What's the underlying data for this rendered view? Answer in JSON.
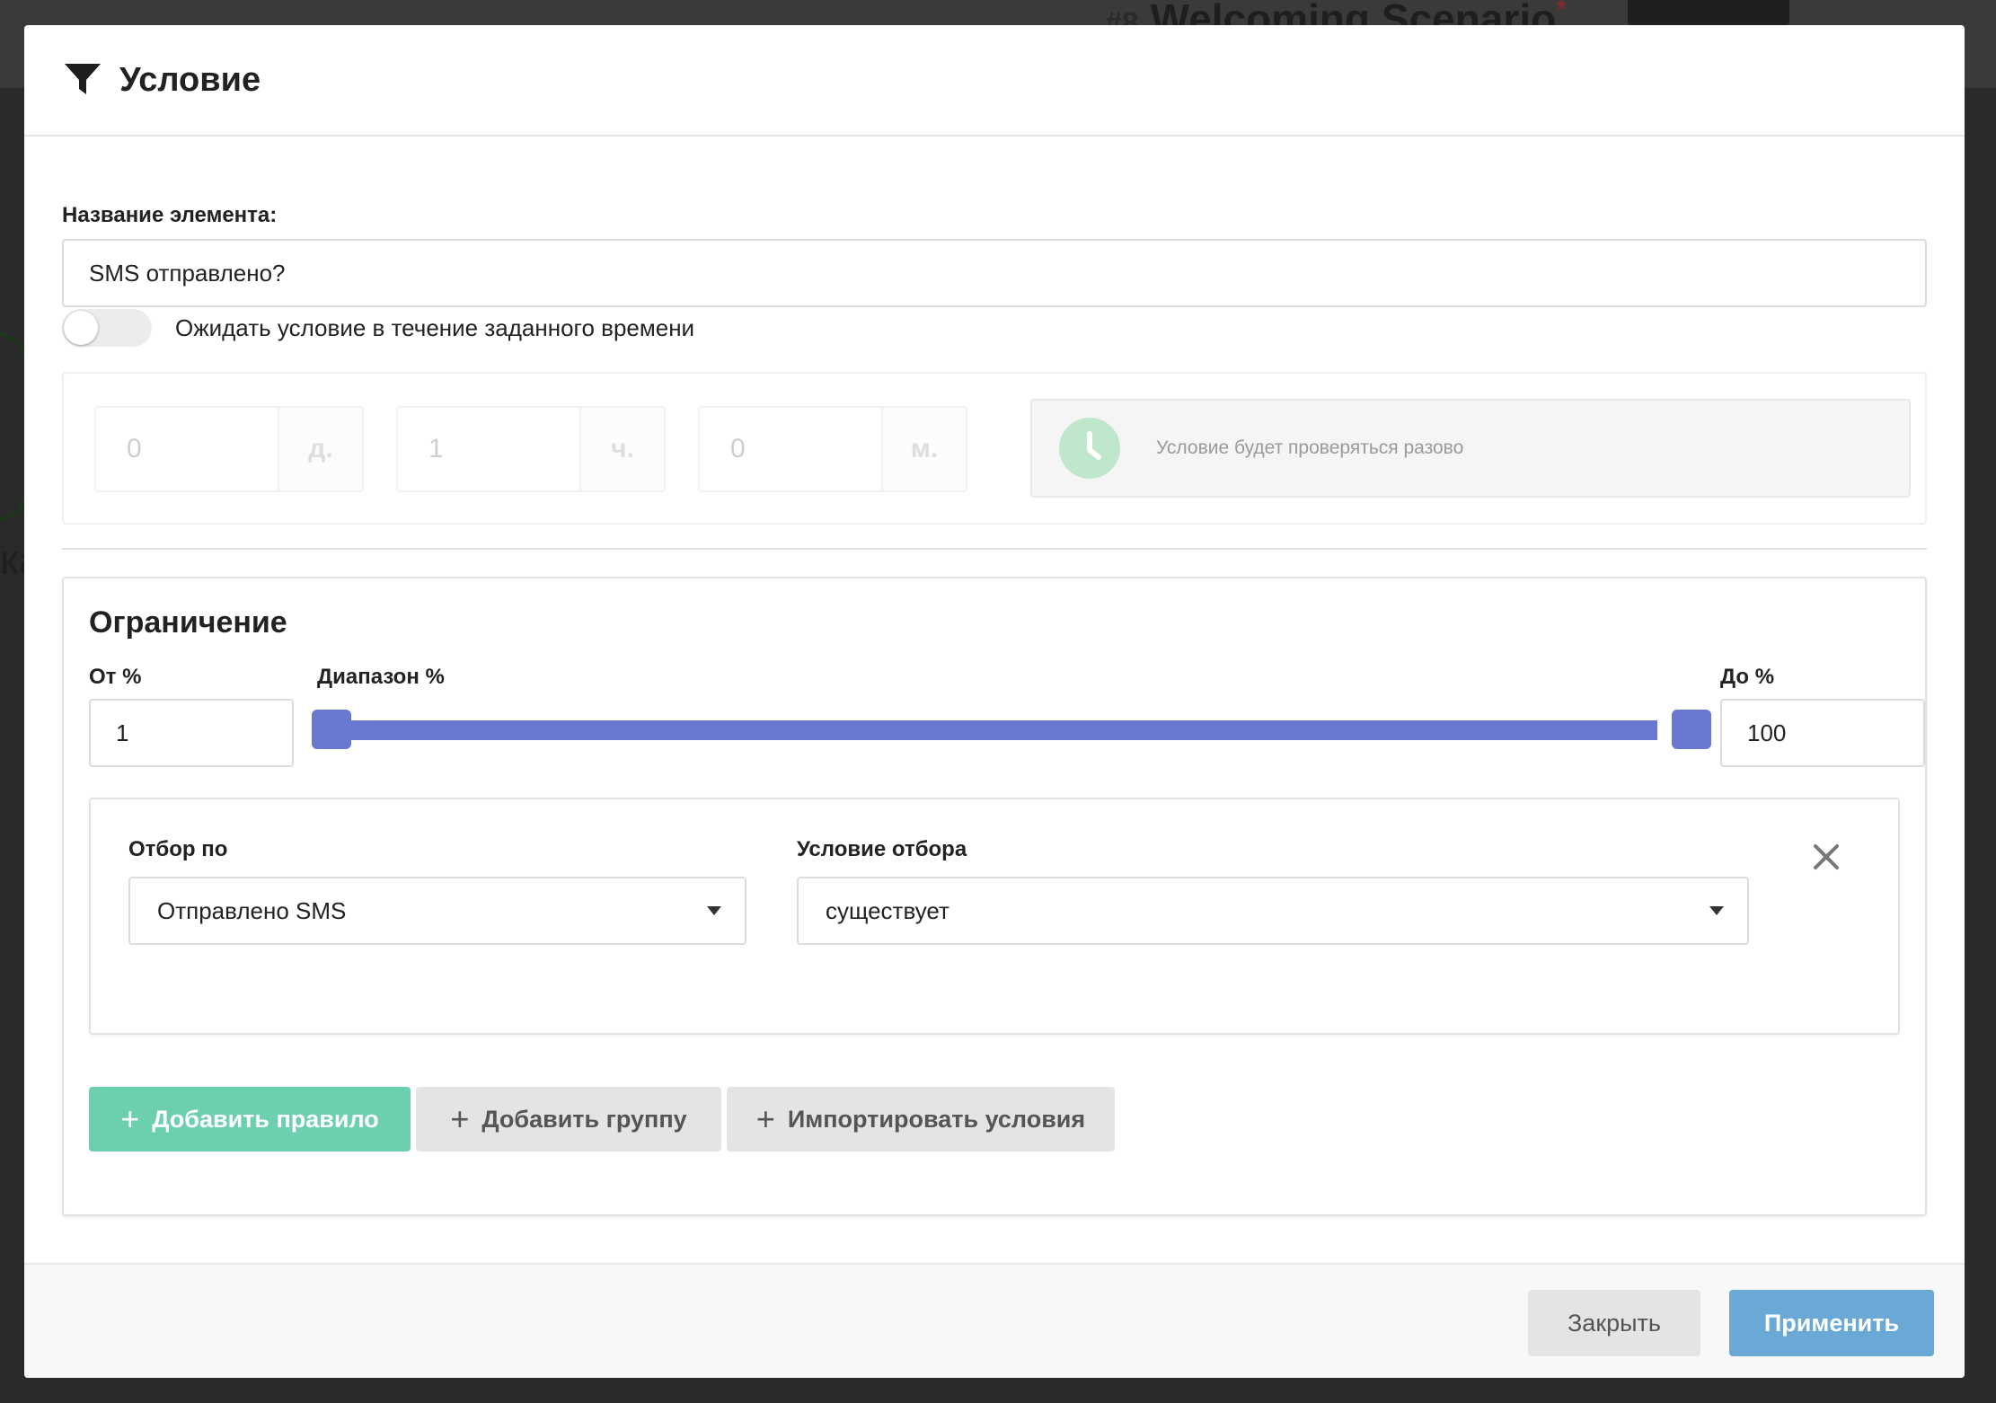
{
  "background": {
    "title": "Welcoming Scenario",
    "title_prefix": "#8",
    "side_text": "ка"
  },
  "modal": {
    "title": "Условие",
    "title_icon": "filter-icon"
  },
  "element_name": {
    "label": "Название элемента:",
    "value": "SMS отправлено?"
  },
  "wait": {
    "toggle_on": false,
    "label": "Ожидать условие в течение заданного времени",
    "days": {
      "value": "0",
      "unit": "д."
    },
    "hours": {
      "value": "1",
      "unit": "ч."
    },
    "minutes": {
      "value": "0",
      "unit": "м."
    },
    "info_icon": "clock-icon",
    "info_text": "Условие будет проверяться разово"
  },
  "limit": {
    "title": "Ограничение",
    "from_label": "От %",
    "from_value": "1",
    "range_label": "Диапазон %",
    "to_label": "До %",
    "to_value": "100",
    "range_from_pct": 1,
    "range_to_pct": 100,
    "accent_color": "#6b78cf"
  },
  "rule": {
    "filter_label": "Отбор по",
    "filter_value": "Отправлено SMS",
    "condition_label": "Условие отбора",
    "condition_value": "существует"
  },
  "actions": {
    "add_rule": "Добавить правило",
    "add_group": "Добавить группу",
    "import_conditions": "Импортировать условия",
    "add_rule_color": "#6ccfae"
  },
  "footer": {
    "close": "Закрыть",
    "apply": "Применить",
    "apply_color": "#6aa9d6"
  }
}
